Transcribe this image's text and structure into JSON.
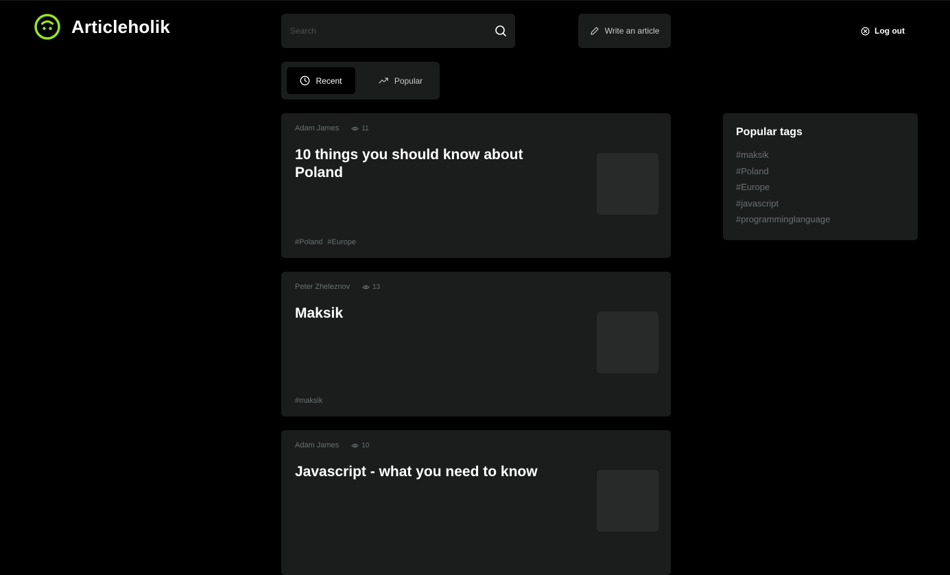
{
  "app": {
    "name": "Articleholik",
    "accent_color": "#9be31d",
    "logo_icon": "smiley-icon"
  },
  "search": {
    "placeholder": "Search",
    "icon": "search-icon"
  },
  "header": {
    "write_label": "Write an article",
    "write_icon": "pencil-icon",
    "logout_label": "Log out",
    "logout_icon": "close-circle-icon"
  },
  "tabs": [
    {
      "label": "Recent",
      "icon": "clock-icon",
      "active": true
    },
    {
      "label": "Popular",
      "icon": "trending-up-icon",
      "active": false
    }
  ],
  "articles": [
    {
      "author": "Adam James",
      "views": "11",
      "title": "10 things you should know about Poland",
      "tags": [
        "#Poland",
        "#Europe"
      ]
    },
    {
      "author": "Peter Zheleznov",
      "views": "13",
      "title": "Maksik",
      "tags": [
        "#maksik"
      ]
    },
    {
      "author": "Adam James",
      "views": "10",
      "title": "Javascript - what you need to know",
      "tags": []
    }
  ],
  "popular_tags": {
    "title": "Popular tags",
    "items": [
      "#maksik",
      "#Poland",
      "#Europe",
      "#javascript",
      "#programminglanguage"
    ]
  }
}
